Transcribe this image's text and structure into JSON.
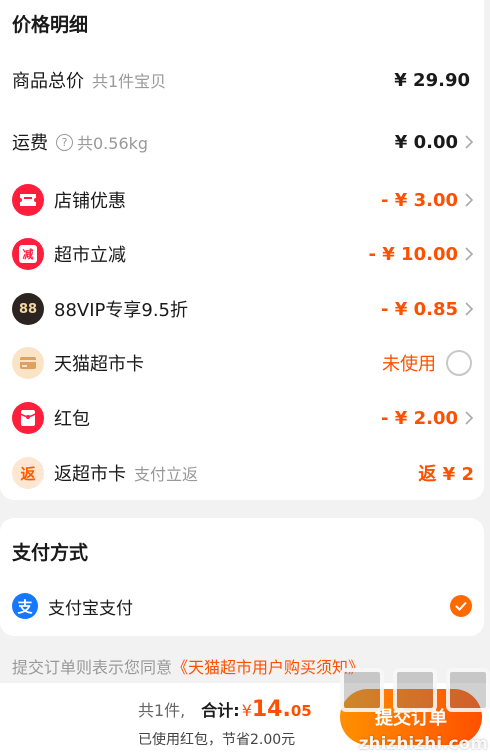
{
  "price_detail": {
    "title": "价格明细",
    "rows": [
      {
        "label": "商品总价",
        "sub": "共1件宝贝",
        "value": "¥ 29.90"
      },
      {
        "label": "运费",
        "sub": "共0.56kg",
        "value": "¥ 0.00"
      },
      {
        "label": "店铺优惠",
        "value": "- ¥ 3.00"
      },
      {
        "label": "超市立减",
        "icon_text": "减",
        "value": "- ¥ 10.00"
      },
      {
        "label": "88VIP专享9.5折",
        "icon_text": "88",
        "value": "- ¥ 0.85"
      },
      {
        "label": "天猫超市卡",
        "value": "未使用"
      },
      {
        "label": "红包",
        "value": "- ¥ 2.00"
      },
      {
        "label": "返超市卡",
        "sub": "支付立返",
        "icon_text": "返",
        "value": "返 ¥ 2"
      }
    ]
  },
  "payment": {
    "title": "支付方式",
    "method_icon_text": "支",
    "method": "支付宝支付"
  },
  "agreement": {
    "prefix": "提交订单则表示您同意",
    "link": "《天猫超市用户购买须知》"
  },
  "bottom": {
    "count": "共1件,",
    "total_label": "合计:",
    "currency": "¥",
    "total_int": "14.",
    "total_dec": "05",
    "savings": "已使用红包，节省2.00元",
    "submit": "提交订单"
  },
  "watermark": {
    "text": "zhizhizhi.com"
  },
  "colors": {
    "accent": "#ff5000",
    "background": "#f2f2f2",
    "card": "#ffffff"
  },
  "icons": [
    "ticket-icon",
    "reduce-icon",
    "vip88-icon",
    "card-icon",
    "redpacket-icon",
    "return-icon",
    "alipay-icon",
    "question-icon",
    "chevron-right-icon",
    "check-icon"
  ]
}
